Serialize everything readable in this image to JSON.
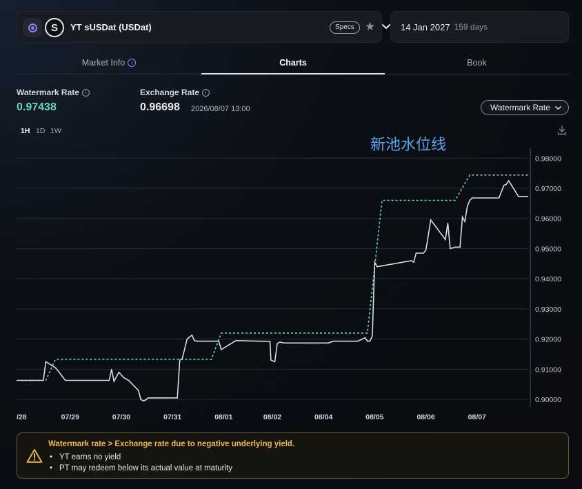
{
  "market": {
    "name": "YT sUSDat (USDat)",
    "logo_letter": "S",
    "specs_label": "Specs",
    "maturity_date": "14 Jan 2027",
    "days_left": "159 days"
  },
  "tabs": [
    {
      "label": "Market Info"
    },
    {
      "label": "Charts"
    },
    {
      "label": "Book"
    }
  ],
  "stats": {
    "watermark_label": "Watermark Rate",
    "watermark_value": "0.97438",
    "exchange_label": "Exchange Rate",
    "exchange_value": "0.96698",
    "exchange_time": "2026/08/07 13:00"
  },
  "dropdown": {
    "selected": "Watermark Rate"
  },
  "periods": [
    "1H",
    "1D",
    "1W"
  ],
  "annotation": "新池水位线",
  "colors": {
    "watermark_line": "#6fd6b5",
    "exchange_line": "#d9dde3",
    "warning_title": "#f0b84a"
  },
  "chart_data": {
    "type": "line",
    "x_tick_labels": [
      "/28",
      "07/29",
      "07/30",
      "07/31",
      "08/01",
      "08/02",
      "08/04",
      "08/05",
      "08/06",
      "08/07"
    ],
    "y_tick_labels": [
      "0.98000",
      "0.97000",
      "0.96000",
      "0.95000",
      "0.94000",
      "0.93000",
      "0.92000",
      "0.91000",
      "0.90000"
    ],
    "ylim": [
      0.8975,
      0.9835
    ],
    "grid": true,
    "series": [
      {
        "style": "dashed",
        "x": [
          0,
          0.6,
          0.8,
          4,
          4.2,
          7.2,
          7.5,
          9.0,
          9.3,
          10.5
        ],
        "y": [
          0.9063,
          0.9063,
          0.9133,
          0.9133,
          0.922,
          0.922,
          0.966,
          0.966,
          0.9744,
          0.9744
        ]
      },
      {
        "style": "solid",
        "x": [
          0,
          0.55,
          0.6,
          0.7,
          0.8,
          0.85,
          1.0,
          1.9,
          1.95,
          2.0,
          2.1,
          2.2,
          2.3,
          2.5,
          2.55,
          2.6,
          2.65,
          2.7,
          3.3,
          3.35,
          3.4,
          3.5,
          3.6,
          3.65,
          3.7,
          4.1,
          4.15,
          4.2,
          4.5,
          5.2,
          5.22,
          5.3,
          5.35,
          5.4,
          5.5,
          6.4,
          6.5,
          7.0,
          7.1,
          7.15,
          7.2,
          7.25,
          7.3,
          7.35,
          7.4,
          8.1,
          8.15,
          8.2,
          8.25,
          8.3,
          8.35,
          8.4,
          8.5,
          8.8,
          8.85,
          8.9,
          9.0,
          9.05,
          9.1,
          9.15,
          9.2,
          9.25,
          9.3,
          9.35,
          9.4,
          9.45,
          9.5,
          9.55,
          9.6,
          9.7,
          9.9,
          10.0,
          10.05,
          10.1,
          10.3,
          10.5
        ],
        "y": [
          0.9063,
          0.9063,
          0.9125,
          0.9115,
          0.9105,
          0.9095,
          0.9063,
          0.9063,
          0.91,
          0.906,
          0.909,
          0.9072,
          0.9063,
          0.903,
          0.9,
          0.8995,
          0.8998,
          0.9005,
          0.9005,
          0.913,
          0.9135,
          0.92,
          0.9213,
          0.9195,
          0.9193,
          0.9193,
          0.9193,
          0.9165,
          0.9195,
          0.9192,
          0.913,
          0.9125,
          0.9185,
          0.919,
          0.9187,
          0.9187,
          0.9193,
          0.9193,
          0.92,
          0.9205,
          0.9193,
          0.9193,
          0.921,
          0.9455,
          0.944,
          0.946,
          0.9455,
          0.9485,
          0.9485,
          0.9485,
          0.9485,
          0.9495,
          0.9595,
          0.953,
          0.9585,
          0.95,
          0.9505,
          0.9505,
          0.9505,
          0.9605,
          0.959,
          0.964,
          0.966,
          0.9668,
          0.9668,
          0.9668,
          0.9668,
          0.9668,
          0.9668,
          0.9668,
          0.9668,
          0.971,
          0.9713,
          0.9725,
          0.9673,
          0.9673
        ]
      }
    ]
  },
  "warning": {
    "title": "Watermark rate > Exchange rate due to negative underlying yield.",
    "bullets": [
      "YT earns no yield",
      "PT may redeem below its actual value at maturity"
    ]
  }
}
